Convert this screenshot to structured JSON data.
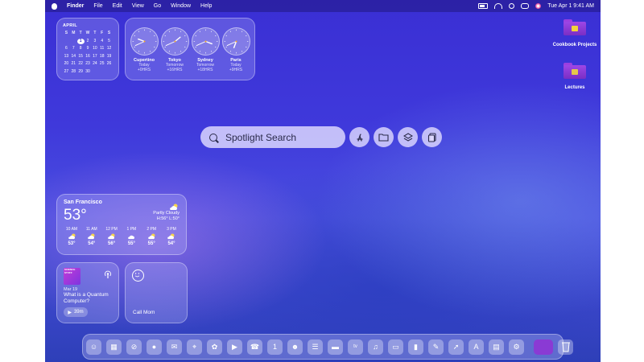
{
  "menubar": {
    "items": [
      "Finder",
      "File",
      "Edit",
      "View",
      "Go",
      "Window",
      "Help"
    ],
    "datetime": "Tue Apr 1  9:41 AM"
  },
  "calendar": {
    "month": "APRIL",
    "weekdays": [
      "S",
      "M",
      "T",
      "W",
      "T",
      "F",
      "S"
    ],
    "rows": [
      [
        "",
        "",
        "1",
        "2",
        "3",
        "4",
        "5"
      ],
      [
        "6",
        "7",
        "8",
        "9",
        "10",
        "11",
        "12"
      ],
      [
        "13",
        "14",
        "15",
        "16",
        "17",
        "18",
        "19"
      ],
      [
        "20",
        "21",
        "22",
        "23",
        "24",
        "25",
        "26"
      ],
      [
        "27",
        "28",
        "29",
        "30",
        "",
        "",
        ""
      ]
    ],
    "today": "1"
  },
  "clocks": [
    {
      "city": "Cupertino",
      "day": "Today",
      "offset": "+0HRS",
      "hour": 9,
      "minute": 41
    },
    {
      "city": "Tokyo",
      "day": "Tomorrow",
      "offset": "+16HRS",
      "hour": 1,
      "minute": 41
    },
    {
      "city": "Sydney",
      "day": "Tomorrow",
      "offset": "+18HRS",
      "hour": 3,
      "minute": 41
    },
    {
      "city": "Paris",
      "day": "Today",
      "offset": "+9HRS",
      "hour": 6,
      "minute": 41
    }
  ],
  "spotlight": {
    "placeholder": "Spotlight Search"
  },
  "spotlight_actions": [
    "app-store-icon",
    "folder-icon",
    "layers-icon",
    "clipboard-icon"
  ],
  "weather": {
    "city": "San Francisco",
    "temp": "53°",
    "condition": "Partly Cloudy",
    "hilo": "H:56° L:50°",
    "hours": [
      {
        "time": "10 AM",
        "temp": "53°",
        "icon": "partly-cloudy-icon"
      },
      {
        "time": "11 AM",
        "temp": "54°",
        "icon": "partly-cloudy-icon"
      },
      {
        "time": "12 PM",
        "temp": "56°",
        "icon": "partly-cloudy-icon"
      },
      {
        "time": "1 PM",
        "temp": "55°",
        "icon": "cloud-icon"
      },
      {
        "time": "2 PM",
        "temp": "55°",
        "icon": "partly-cloudy-icon"
      },
      {
        "time": "3 PM",
        "temp": "54°",
        "icon": "partly-cloudy-icon"
      }
    ]
  },
  "podcast": {
    "art_text": "SCIENCE STUFF",
    "date": "Mar 19",
    "title": "What is a Quantum Computer?",
    "duration": "39m"
  },
  "contact_widget": {
    "label": "Call Mom"
  },
  "desktop_folders": [
    {
      "label": "Cookbook Projects"
    },
    {
      "label": "Lectures"
    }
  ],
  "dock": [
    "finder-icon",
    "launchpad-icon",
    "safari-icon",
    "messages-icon",
    "mail-icon",
    "maps-icon",
    "photos-icon",
    "facetime-icon",
    "phone-icon",
    "calendar-icon",
    "contacts-icon",
    "reminders-icon",
    "notes-icon",
    "tv-icon",
    "music-icon",
    "keynote-icon",
    "numbers-icon",
    "pages-icon",
    "launcher-icon",
    "app-store-icon",
    "preview-icon",
    "system-settings-icon"
  ],
  "colors": {
    "accent": "#3a32c8",
    "folder": "#8a3ad4"
  }
}
